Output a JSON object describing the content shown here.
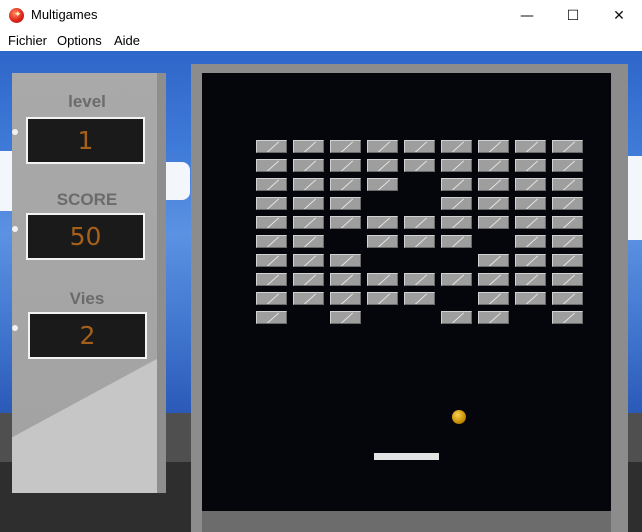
{
  "window": {
    "title": "Multigames",
    "minimize": "—",
    "maximize": "☐",
    "close": "✕"
  },
  "menu": {
    "items": [
      "Fichier",
      "Options",
      "Aide"
    ]
  },
  "stats": {
    "level_label": "level",
    "level_value": "1",
    "score_label": "SCORE",
    "score_value": "50",
    "lives_label": "Vies",
    "lives_value": "2"
  },
  "game": {
    "brick_map": [
      "111111111",
      "111111111",
      "111101111",
      "111001111",
      "111111111",
      "110111011",
      "111000111",
      "111111111",
      "111110111",
      "101001101"
    ],
    "colors": {
      "brick": "#9e9e9e",
      "field": "#05050c",
      "ball": "#c98f07",
      "paddle": "#e4e4e4"
    }
  }
}
